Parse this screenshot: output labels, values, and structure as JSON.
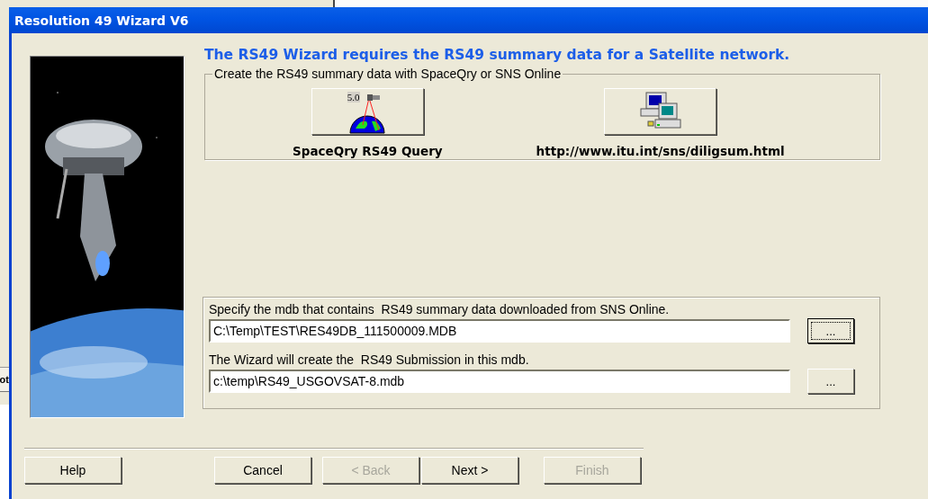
{
  "background_window": {
    "tab_label": "ot"
  },
  "window": {
    "title": "Resolution 49 Wizard V6"
  },
  "heading": "The RS49 Wizard requires the RS49 summary data for a Satellite network.",
  "source_group": {
    "legend": "Create the RS49 summary data with SpaceQry or SNS Online",
    "options": [
      {
        "kind": "spaceqry",
        "badge": "5.0",
        "label": "SpaceQry RS49 Query"
      },
      {
        "kind": "web",
        "label": "http://www.itu.int/sns/diligsum.html"
      }
    ]
  },
  "file_group": {
    "fields": [
      {
        "label": "Specify the mdb that contains  RS49 summary data downloaded from SNS Online.",
        "value": "C:\\Temp\\TEST\\RES49DB_111500009.MDB",
        "browse": "...",
        "focused": true
      },
      {
        "label": "The Wizard will create the  RS49 Submission in this mdb.",
        "value": "c:\\temp\\RS49_USGOVSAT-8.mdb",
        "browse": "...",
        "focused": false
      }
    ]
  },
  "buttons": [
    {
      "kind": "help",
      "label": "Help",
      "disabled": false
    },
    {
      "kind": "cancel",
      "label": "Cancel",
      "disabled": false
    },
    {
      "kind": "back",
      "label": "< Back",
      "disabled": true
    },
    {
      "kind": "next",
      "label": "Next >",
      "disabled": false
    },
    {
      "kind": "finish",
      "label": "Finish",
      "disabled": true
    }
  ]
}
